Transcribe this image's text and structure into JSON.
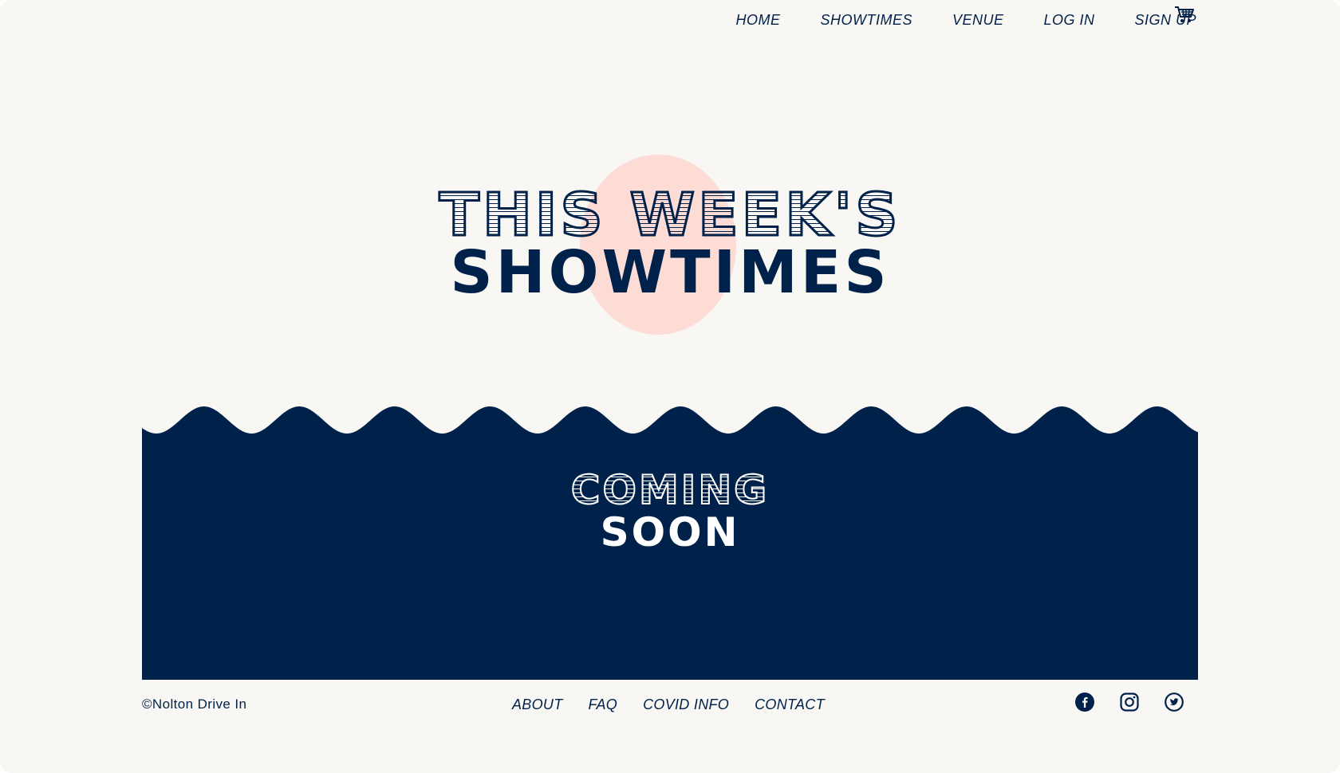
{
  "nav": {
    "items": [
      {
        "label": "HOME"
      },
      {
        "label": "SHOWTIMES"
      },
      {
        "label": "VENUE"
      },
      {
        "label": "LOG IN"
      },
      {
        "label": "SIGN UP"
      }
    ],
    "cart_icon": "shopping-cart-icon"
  },
  "hero": {
    "line1": "THIS WEEK'S",
    "line2": "SHOWTIMES"
  },
  "band": {
    "line1": "COMING",
    "line2": "SOON"
  },
  "footer": {
    "copyright": "©Nolton Drive In",
    "links": [
      {
        "label": "ABOUT"
      },
      {
        "label": "FAQ"
      },
      {
        "label": "COVID INFO"
      },
      {
        "label": "CONTACT"
      }
    ],
    "social_icons": [
      "facebook-icon",
      "instagram-icon",
      "twitter-icon"
    ]
  },
  "colors": {
    "navy": "#00224a",
    "background": "#f8f7f3",
    "pink": "#fddcd6",
    "white": "#ffffff"
  }
}
